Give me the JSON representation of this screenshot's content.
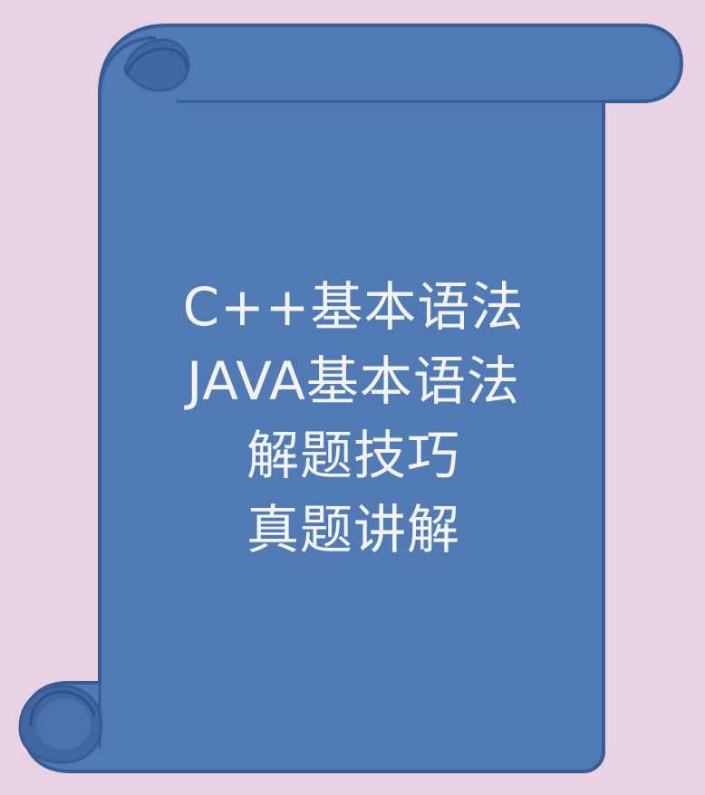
{
  "colors": {
    "background": "#e8d2e3",
    "scroll_fill": "#5179b3",
    "scroll_shadow": "#4266a0",
    "scroll_outline": "#365d95",
    "text": "#f2f4f8"
  },
  "icons": {
    "scroll": "scroll-icon"
  },
  "scroll": {
    "lines": [
      "C++基本语法",
      "JAVA基本语法",
      "解题技巧",
      "真题讲解"
    ]
  }
}
